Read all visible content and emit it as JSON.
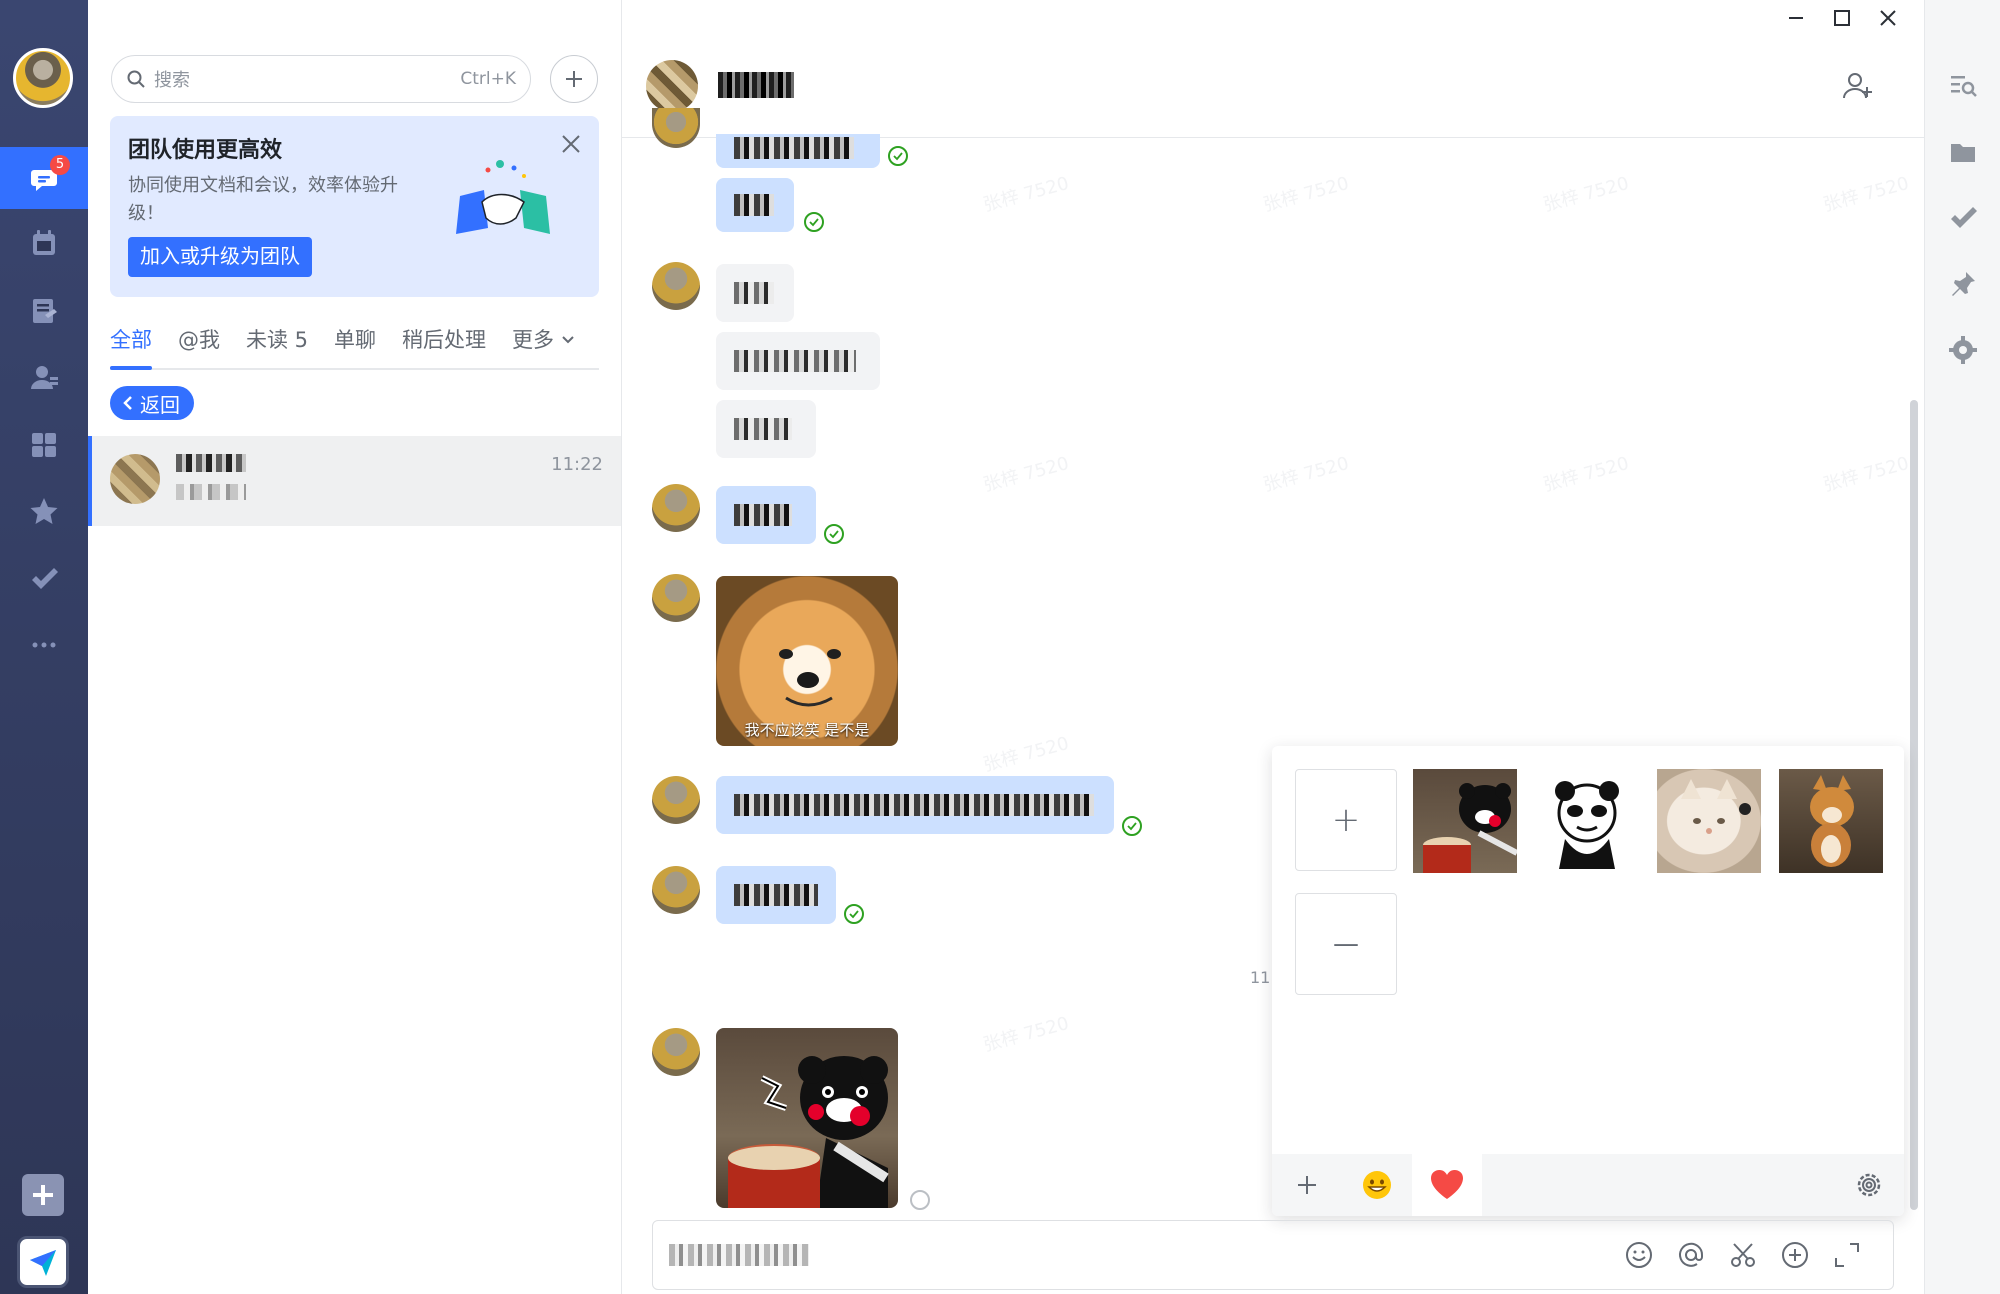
{
  "nav": {
    "unread_badge": "5",
    "items": [
      {
        "name": "messages-icon"
      },
      {
        "name": "calendar-icon"
      },
      {
        "name": "docs-icon"
      },
      {
        "name": "contacts-icon"
      },
      {
        "name": "workplace-icon"
      },
      {
        "name": "favorites-icon"
      },
      {
        "name": "tasks-icon"
      },
      {
        "name": "more-icon"
      }
    ],
    "accent": "#3370ff",
    "background": "#344068"
  },
  "list": {
    "search_placeholder": "搜索",
    "search_shortcut": "Ctrl+K",
    "promo": {
      "title": "团队使用更高效",
      "description": "协同使用文档和会议，效率体验升级！",
      "button": "加入或升级为团队"
    },
    "tabs": [
      "全部",
      "@我",
      "未读 5",
      "单聊",
      "稍后处理",
      "更多"
    ],
    "back_label": "返回",
    "chats": [
      {
        "time": "11:22"
      }
    ]
  },
  "chat": {
    "watermark": "张梓 7520",
    "partial_time": "11",
    "sticker_caption": "我不应该笑 是不是"
  },
  "sticker_panel": {
    "add_label": "+",
    "remove_label": "—",
    "stickers": [
      "kumamon-drum",
      "panda-meme",
      "cat-photo",
      "shiba-photo"
    ]
  },
  "colors": {
    "self_bubble": "#cce0ff",
    "other_bubble": "#f2f3f5",
    "read_check": "#2ea121",
    "heart": "#f54a45"
  }
}
